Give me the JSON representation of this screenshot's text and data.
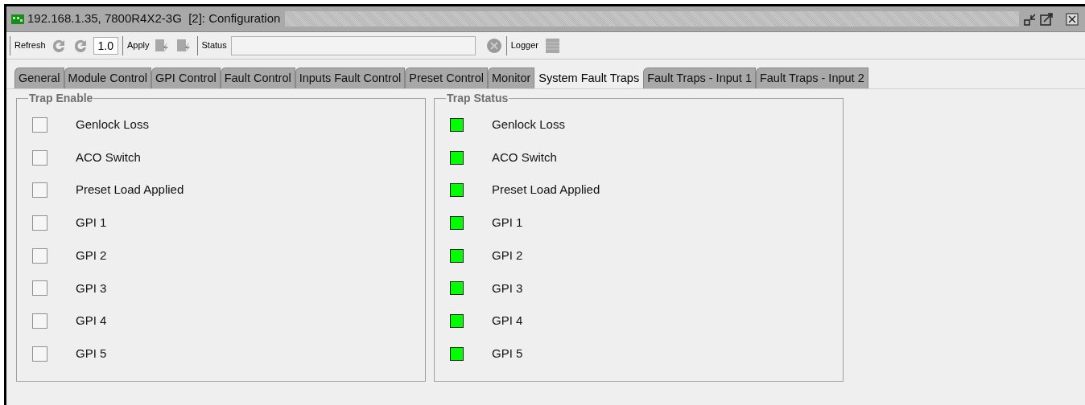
{
  "window": {
    "title": "192.168.1.35, 7800R4X2-3G  [2]: Configuration"
  },
  "toolbar": {
    "refresh_label": "Refresh",
    "refresh_interval": "1.0",
    "apply_label": "Apply",
    "status_label": "Status",
    "logger_label": "Logger"
  },
  "tabs": [
    {
      "label": "General",
      "selected": false
    },
    {
      "label": "Module Control",
      "selected": false
    },
    {
      "label": "GPI Control",
      "selected": false
    },
    {
      "label": "Fault Control",
      "selected": false
    },
    {
      "label": "Inputs Fault Control",
      "selected": false
    },
    {
      "label": "Preset Control",
      "selected": false
    },
    {
      "label": "Monitor",
      "selected": false
    },
    {
      "label": "System Fault Traps",
      "selected": true
    },
    {
      "label": "Fault Traps - Input 1",
      "selected": false
    },
    {
      "label": "Fault Traps - Input 2",
      "selected": false
    }
  ],
  "trap_enable": {
    "title": "Trap Enable",
    "items": [
      {
        "label": "Genlock Loss",
        "checked": false
      },
      {
        "label": "ACO Switch",
        "checked": false
      },
      {
        "label": "Preset Load Applied",
        "checked": false
      },
      {
        "label": "GPI 1",
        "checked": false
      },
      {
        "label": "GPI 2",
        "checked": false
      },
      {
        "label": "GPI 3",
        "checked": false
      },
      {
        "label": "GPI 4",
        "checked": false
      },
      {
        "label": "GPI 5",
        "checked": false
      }
    ]
  },
  "trap_status": {
    "title": "Trap Status",
    "items": [
      {
        "label": "Genlock Loss",
        "on": true
      },
      {
        "label": "ACO Switch",
        "on": true
      },
      {
        "label": "Preset Load Applied",
        "on": true
      },
      {
        "label": "GPI 1",
        "on": true
      },
      {
        "label": "GPI 2",
        "on": true
      },
      {
        "label": "GPI 3",
        "on": true
      },
      {
        "label": "GPI 4",
        "on": true
      },
      {
        "label": "GPI 5",
        "on": true
      }
    ]
  }
}
